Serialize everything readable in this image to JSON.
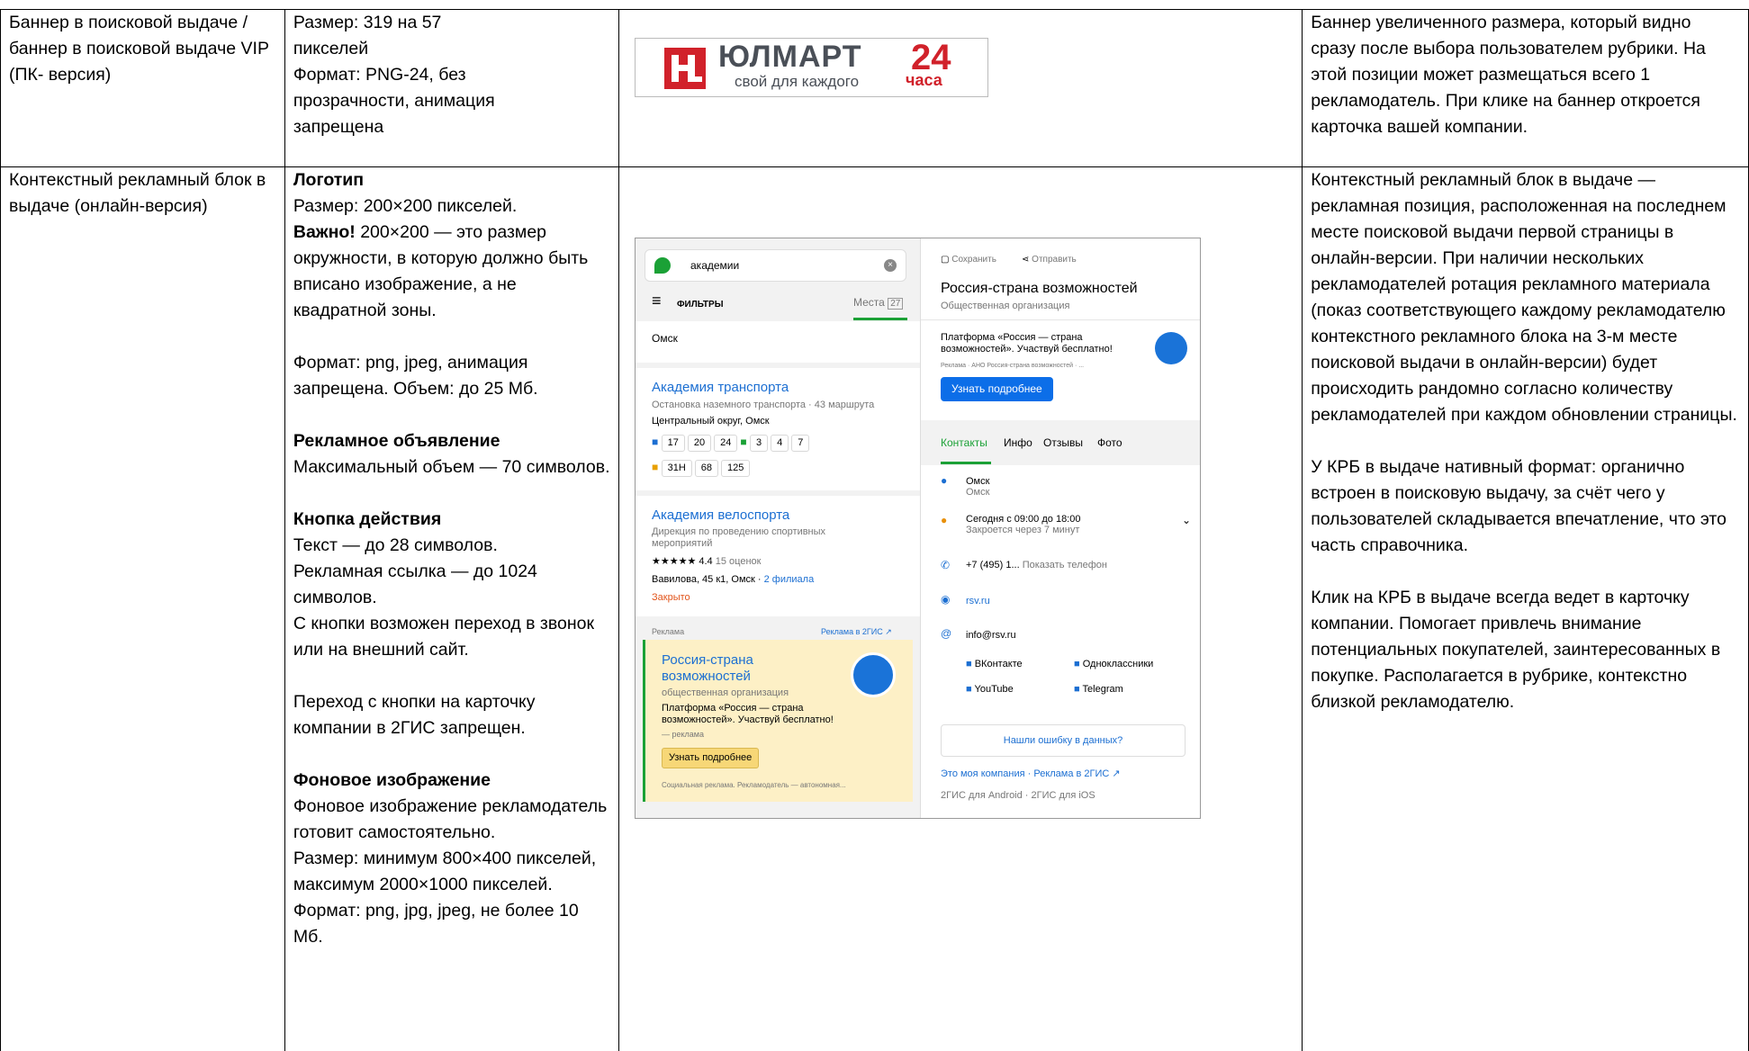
{
  "table": {
    "row1": {
      "c1": "Баннер в поисковой выдаче / баннер в поисковой выдаче VIP (ПК- версия)",
      "c2": [
        "Размер: 319 на 57",
        "пикселей",
        "Формат: PNG-24, без",
        "прозрачности, анимация",
        "запрещена"
      ],
      "c4": "Баннер увеличенного размера, который видно сразу после выбора пользователем рубрики. На этой позиции может размещаться всего 1 рекламодатель. При клике на баннер откроется карточка вашей компании."
    },
    "row2": {
      "c1": "Контекстный рекламный блок в выдаче (онлайн-версия)",
      "logo_title": "Логотип",
      "logo_size": "Размер: 200×200 пикселей.",
      "important_bold": "Важно!",
      "important_text": " 200×200 — это размер окружности, в которую должно быть вписано изображение, а не квадратной зоны.",
      "format1": "Формат: png, jpeg, анимация запрещена. Объем: до 25 Мб.",
      "ad_title": "Рекламное объявление",
      "ad_text": "Максимальный объем — 70 символов.",
      "cta_title": "Кнопка действия",
      "cta_text1": "Текст — до 28 символов.",
      "cta_text2": "Рекламная ссылка — до 1024 символов.",
      "cta_text3": "С кнопки возможен переход в звонок или на внешний сайт.",
      "cta_ban": "Переход с кнопки на карточку компании в 2ГИС запрещен.",
      "bg_title": "Фоновое изображение",
      "bg_text1": "Фоновое изображение рекламодатель готовит самостоятельно.",
      "bg_text2": "Размер: минимум 800×400 пикселей, максимум 2000×1000 пикселей.",
      "bg_text3": "Формат: png, jpg, jpeg, не более 10 Мб.",
      "c4_p1": "Контекстный рекламный блок в выдаче — рекламная позиция, расположенная на последнем месте поисковой выдачи первой страницы в онлайн-версии. При наличии нескольких рекламодателей ротация рекламного материала (показ соответствующего каждому рекламодателю контекстного рекламного блока на 3-м месте поисковой выдачи в онлайн-версии) будет происходить рандомно согласно количеству рекламодателей при каждом обновлении страницы.",
      "c4_p2": "У КРБ в выдаче нативный формат: органично встроен в поисковую выдачу, за счёт чего у пользователей складывается впечатление, что это часть справочника.",
      "c4_p3": "Клик на КРБ в выдаче всегда ведет в карточку компании. Помогает привлечь внимание потенциальных покупателей, заинтересованных в покупке. Располагается в рубрике, контекстно близкой рекламодателю."
    }
  },
  "banner": {
    "brand": "ЮЛМАРТ",
    "num": "24",
    "tagline": "свой для каждого",
    "tagline2": "часа",
    "colors": {
      "red": "#d1212a",
      "grey": "#4a4f57"
    }
  },
  "app": {
    "search_value": "академии",
    "filters": "ФИЛЬТРЫ",
    "places": "Места",
    "places_count": "27",
    "city_top": "Омск",
    "r1": {
      "name": "Академия транспорта",
      "desc": "Остановка наземного транспорта",
      "routes": "43 маршрута",
      "district": "Центральный округ, Омск",
      "bus": [
        "17",
        "20",
        "24"
      ],
      "tram": [
        "3",
        "4",
        "7"
      ],
      "bus2": [
        "31Н",
        "68",
        "125"
      ]
    },
    "r2": {
      "name": "Академия велоспорта",
      "desc": "Дирекция по проведению спортивных мероприятий",
      "stars": "★★★★★",
      "rating": "4.4",
      "reviews": "15 оценок",
      "addr": "Вавилова, 45 к1, Омск",
      "branches": "2 филиала",
      "closed": "Закрыто"
    },
    "ad_label": "Реклама",
    "ad_link": "Реклама в 2ГИС ↗",
    "ad": {
      "title": "Россия-страна возможностей",
      "sub": "общественная организация",
      "text": "Платформа «Россия — страна возможностей». Участвуй бесплатно!",
      "note": "— реклама",
      "btn": "Узнать подробнее",
      "disclaimer": "Социальная реклама. Рекламодатель — автономная..."
    },
    "card": {
      "save": "Сохранить",
      "share": "Отправить",
      "title": "Россия-страна возможностей",
      "type": "Общественная организация",
      "promo": "Платформа «Россия — страна возможностей». Участвуй бесплатно!",
      "promo_note": "Реклама · АНО Россия-страна возможностей · ...",
      "btn": "Узнать подробнее",
      "tabs": [
        "Контакты",
        "Инфо",
        "Отзывы",
        "Фото"
      ],
      "city": "Омск",
      "city2": "Омск",
      "hours": "Сегодня с 09:00 до 18:00",
      "closes": "Закроется через 7 минут",
      "phone": "+7 (495) 1...",
      "show_phone": "Показать телефон",
      "site": "rsv.ru",
      "email": "info@rsv.ru",
      "vk": "ВКонтакте",
      "ok": "Одноклассники",
      "yt": "YouTube",
      "tg": "Telegram",
      "error_btn": "Нашли ошибку в данных?",
      "my_company": "Это моя компания",
      "ad_2gis": "Реклама в 2ГИС ↗",
      "apps": "2ГИС для Android · 2ГИС для iOS"
    },
    "colors": {
      "green": "#1ba136",
      "blue": "#1c6fd2",
      "ad_bg": "#fdf0c6"
    }
  }
}
